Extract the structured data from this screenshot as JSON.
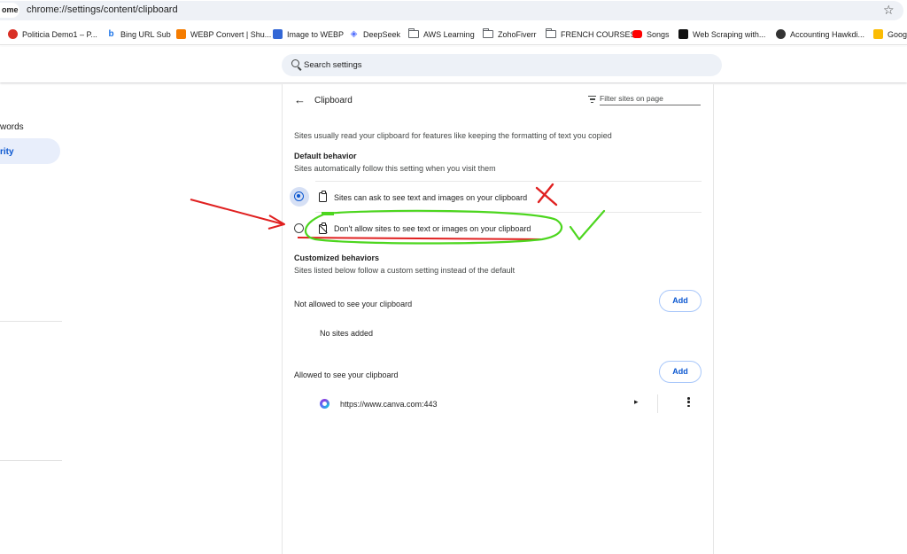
{
  "browser": {
    "tab_chip": "ome",
    "url": "chrome://settings/content/clipboard",
    "bookmarks": [
      {
        "label": "Politicia Demo1 – P...",
        "icon": "red-circle-icon"
      },
      {
        "label": "Bing URL Sub",
        "icon": "bing-icon"
      },
      {
        "label": "WEBP Convert | Shu...",
        "icon": "webp-orange-icon"
      },
      {
        "label": "Image to WEBP",
        "icon": "webp-blue-icon"
      },
      {
        "label": "DeepSeek",
        "icon": "deepseek-icon"
      },
      {
        "label": "AWS Learning",
        "icon": "folder-icon"
      },
      {
        "label": "ZohoFiverr",
        "icon": "folder-icon"
      },
      {
        "label": "FRENCH COURSES",
        "icon": "folder-icon"
      },
      {
        "label": "Songs",
        "icon": "youtube-icon"
      },
      {
        "label": "Web Scraping with...",
        "icon": "black-square-icon"
      },
      {
        "label": "Accounting Hawkdi...",
        "icon": "github-icon"
      },
      {
        "label": "Goog",
        "icon": "yellow-icon"
      }
    ]
  },
  "settings": {
    "search_placeholder": "Search settings",
    "nav": {
      "passwords": "words",
      "privacy": "rity"
    },
    "page_title": "Clipboard",
    "filter_placeholder": "Filter sites on page",
    "description": "Sites usually read your clipboard for features like keeping the formatting of text you copied",
    "default_behavior": {
      "title": "Default behavior",
      "subtitle": "Sites automatically follow this setting when you visit them",
      "options": [
        {
          "label": "Sites can ask to see text and images on your clipboard",
          "selected": true
        },
        {
          "label": "Don't allow sites to see text or images on your clipboard",
          "selected": false
        }
      ]
    },
    "customized": {
      "title": "Customized behaviors",
      "subtitle": "Sites listed below follow a custom setting instead of the default"
    },
    "not_allowed": {
      "label": "Not allowed to see your clipboard",
      "add": "Add",
      "empty": "No sites added"
    },
    "allowed": {
      "label": "Allowed to see your clipboard",
      "add": "Add",
      "sites": [
        {
          "url": "https://www.canva.com:443"
        }
      ]
    }
  },
  "colors": {
    "accent": "#0b57d0",
    "annotation_red": "#e02020",
    "annotation_green": "#4cd61e"
  }
}
